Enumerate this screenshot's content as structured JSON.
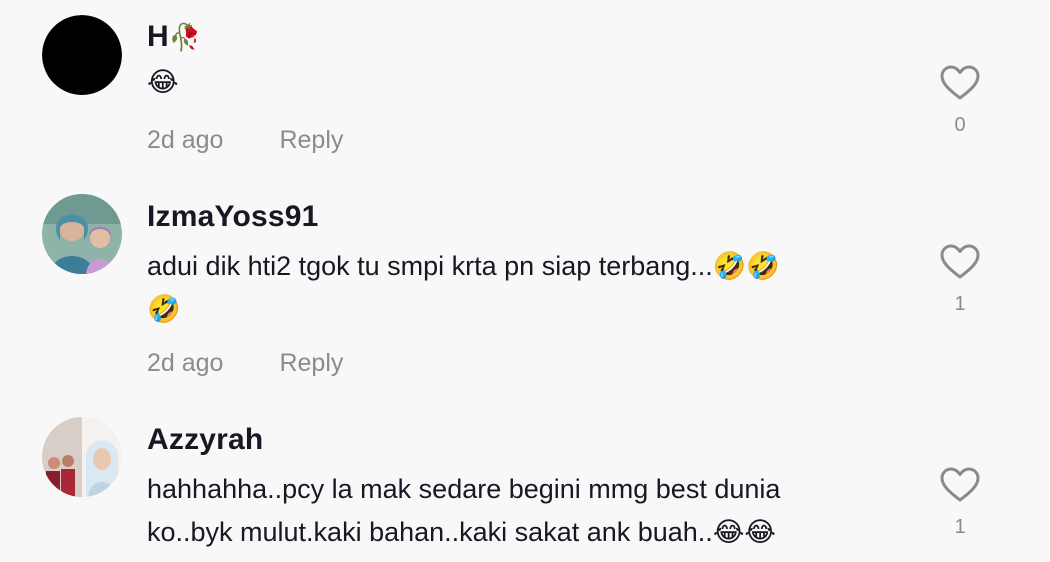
{
  "comments": [
    {
      "username": "H",
      "username_emoji": "🥀",
      "text": "😂",
      "time": "2d ago",
      "reply_label": "Reply",
      "likes": "0",
      "avatar_color": "#000000"
    },
    {
      "username": "IzmaYoss91",
      "text": "adui dik hti2 tgok tu smpi krta pn siap terbang...🤣🤣\n🤣",
      "time": "2d ago",
      "reply_label": "Reply",
      "likes": "1"
    },
    {
      "username": "Azzyrah",
      "text": "hahhahha..pcy la mak sedare begini mmg best dunia\nko..byk mulut.kaki bahan..kaki sakat ank buah..😂😂",
      "time": "",
      "reply_label": "",
      "likes": "1"
    }
  ],
  "colors": {
    "background": "#f8f8f8",
    "text_primary": "#161823",
    "text_secondary": "#8a8b91",
    "heart_outline": "#8a8b91"
  },
  "icons": {
    "like": "heart-outline-icon"
  }
}
